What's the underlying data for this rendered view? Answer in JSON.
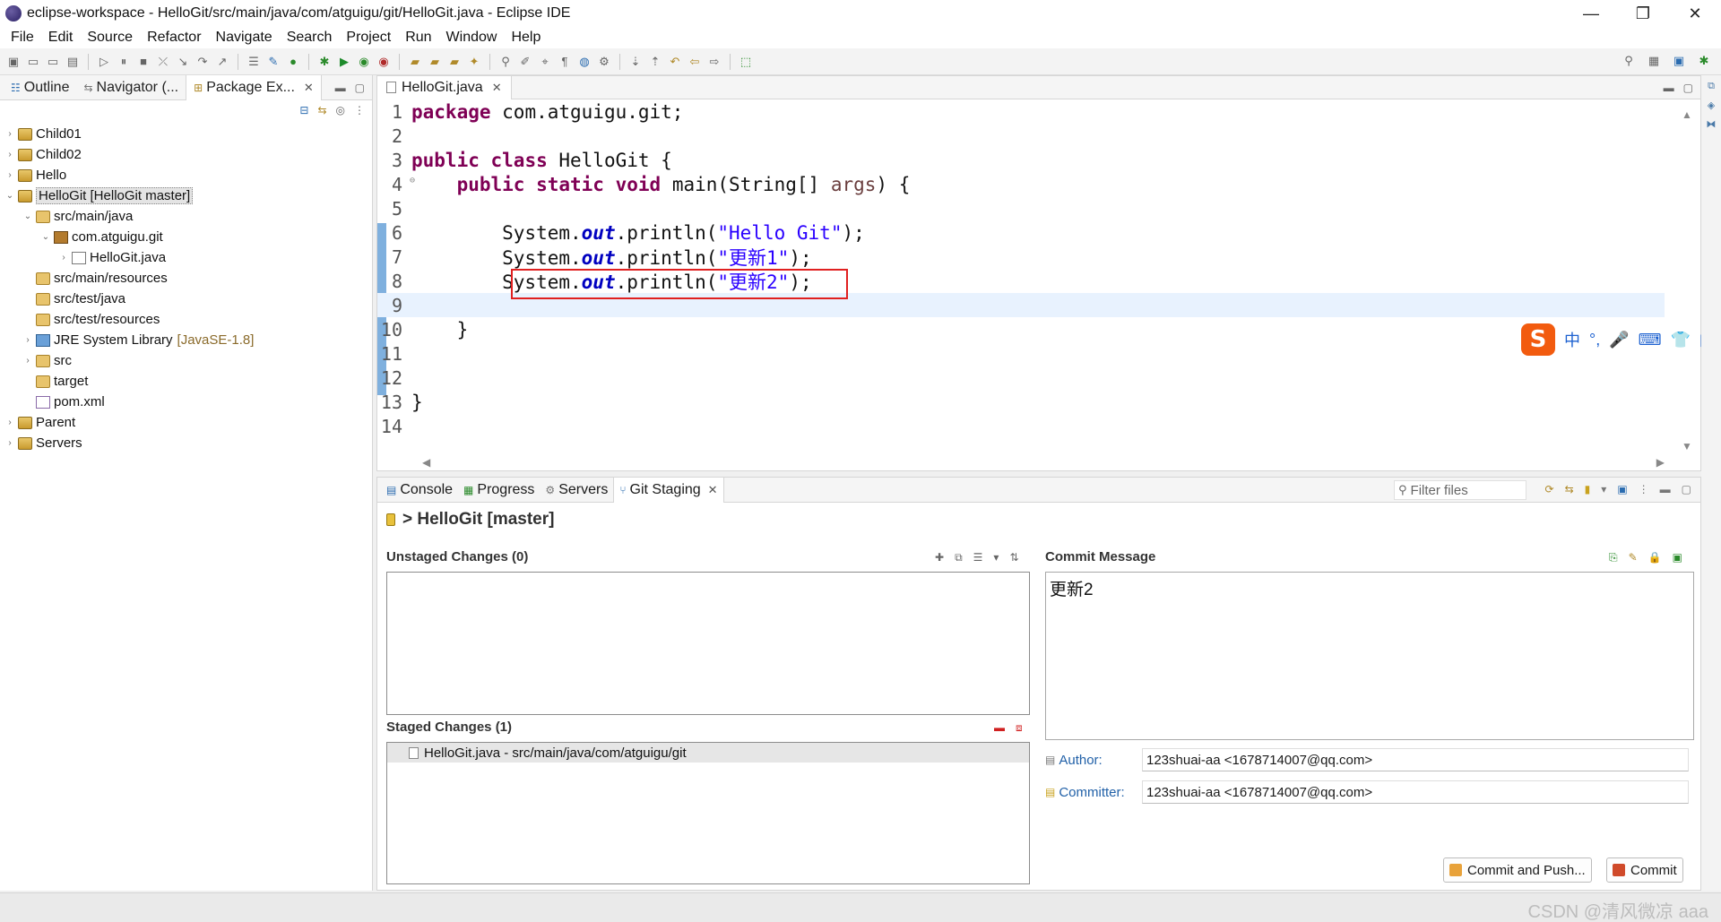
{
  "window": {
    "title": "eclipse-workspace - HelloGit/src/main/java/com/atguigu/git/HelloGit.java - Eclipse IDE",
    "minimize": "—",
    "maximize": "❐",
    "close": "✕"
  },
  "menu": [
    "File",
    "Edit",
    "Source",
    "Refactor",
    "Navigate",
    "Search",
    "Project",
    "Run",
    "Window",
    "Help"
  ],
  "left_panel": {
    "tabs": [
      {
        "label": "Outline"
      },
      {
        "label": "Navigator (..."
      },
      {
        "label": "Package Ex..."
      }
    ],
    "tree": [
      {
        "label": "Child01",
        "indent": 0,
        "twisty": "›",
        "icon": "proj"
      },
      {
        "label": "Child02",
        "indent": 0,
        "twisty": "›",
        "icon": "proj"
      },
      {
        "label": "Hello",
        "indent": 0,
        "twisty": "›",
        "icon": "proj"
      },
      {
        "label": "HelloGit [HelloGit master]",
        "indent": 0,
        "twisty": "⌄",
        "icon": "proj",
        "selected": true
      },
      {
        "label": "src/main/java",
        "indent": 1,
        "twisty": "⌄",
        "icon": "folder"
      },
      {
        "label": "com.atguigu.git",
        "indent": 2,
        "twisty": "⌄",
        "icon": "pkg"
      },
      {
        "label": "HelloGit.java",
        "indent": 3,
        "twisty": "›",
        "icon": "java"
      },
      {
        "label": "src/main/resources",
        "indent": 1,
        "twisty": "",
        "icon": "folder"
      },
      {
        "label": "src/test/java",
        "indent": 1,
        "twisty": "",
        "icon": "folder"
      },
      {
        "label": "src/test/resources",
        "indent": 1,
        "twisty": "",
        "icon": "folder"
      },
      {
        "label": "JRE System Library",
        "suffix": "[JavaSE-1.8]",
        "indent": 1,
        "twisty": "›",
        "icon": "lib"
      },
      {
        "label": "src",
        "indent": 1,
        "twisty": "›",
        "icon": "folder"
      },
      {
        "label": "target",
        "indent": 1,
        "twisty": "",
        "icon": "folder"
      },
      {
        "label": "pom.xml",
        "indent": 1,
        "twisty": "",
        "icon": "xml"
      },
      {
        "label": "Parent",
        "indent": 0,
        "twisty": "›",
        "icon": "proj"
      },
      {
        "label": "Servers",
        "indent": 0,
        "twisty": "›",
        "icon": "proj"
      }
    ]
  },
  "editor": {
    "tab_label": "HelloGit.java",
    "line_numbers": [
      "1",
      "2",
      "3",
      "4",
      "5",
      "6",
      "7",
      "8",
      "9",
      "10",
      "11",
      "12",
      "13",
      "14"
    ],
    "current_line": 9
  },
  "ime": {
    "logo": "S",
    "items": [
      "中",
      "°,",
      "🎤",
      "⌨",
      "👕",
      "▦"
    ]
  },
  "bottom_panel": {
    "tabs": [
      {
        "label": "Console"
      },
      {
        "label": "Progress"
      },
      {
        "label": "Servers"
      },
      {
        "label": "Git Staging",
        "active": true
      }
    ],
    "filter_placeholder": "Filter files",
    "repo_header": "> HelloGit [master]",
    "unstaged_label": "Unstaged Changes (0)",
    "staged_label": "Staged Changes (1)",
    "staged_items": [
      "HelloGit.java - src/main/java/com/atguigu/git"
    ],
    "commit_message_label": "Commit Message",
    "commit_message": "更新2",
    "author_label": "Author:",
    "author_value": "123shuai-aa <1678714007@qq.com>",
    "committer_label": "Committer:",
    "committer_value": "123shuai-aa <1678714007@qq.com>",
    "commit_and_push_label": "Commit and Push...",
    "commit_label": "Commit"
  },
  "status": {
    "watermark": "CSDN @清风微凉 aaa"
  }
}
